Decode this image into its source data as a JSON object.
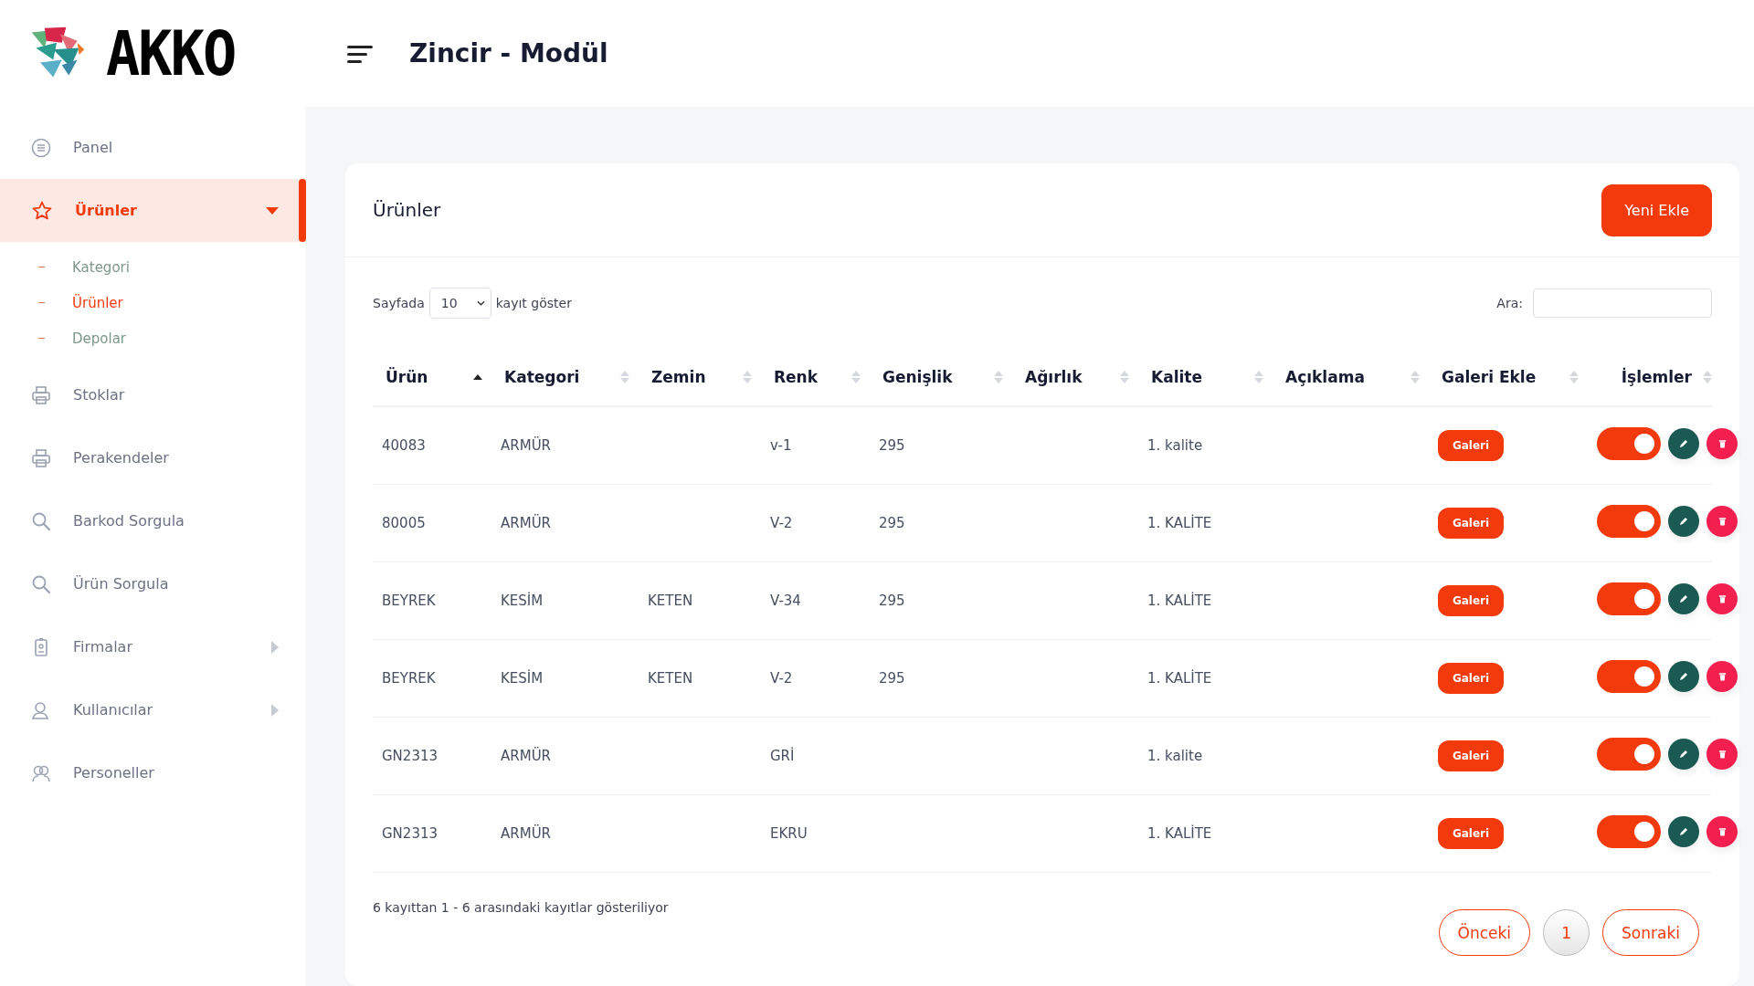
{
  "logo": {
    "text": "AKKO"
  },
  "header": {
    "title": "Zincir - Modül"
  },
  "sidebar": {
    "items": [
      {
        "label": "Panel",
        "kind": "list",
        "selected": false
      },
      {
        "label": "Ürünler",
        "kind": "star",
        "selected": true,
        "expanded": true,
        "children": [
          {
            "label": "Kategori",
            "selected": false
          },
          {
            "label": "Ürünler",
            "selected": true
          },
          {
            "label": "Depolar",
            "selected": false
          }
        ]
      },
      {
        "label": "Stoklar",
        "kind": "printer",
        "selected": false
      },
      {
        "label": "Perakendeler",
        "kind": "printer",
        "selected": false
      },
      {
        "label": "Barkod Sorgula",
        "kind": "search",
        "selected": false
      },
      {
        "label": "Ürün Sorgula",
        "kind": "search",
        "selected": false
      },
      {
        "label": "Firmalar",
        "kind": "badge",
        "selected": false,
        "expanded": false
      },
      {
        "label": "Kullanıcılar",
        "kind": "user",
        "selected": false,
        "expanded": false
      },
      {
        "label": "Personeller",
        "kind": "users",
        "selected": false
      }
    ]
  },
  "card": {
    "title": "Ürünler",
    "add_button": "Yeni Ekle",
    "length": {
      "before": "Sayfada",
      "value": "10",
      "after": "kayıt göster"
    },
    "search": {
      "label": "Ara:"
    },
    "table": {
      "columns": [
        {
          "label": "Ürün",
          "sorted": true
        },
        {
          "label": "Kategori",
          "sorted": false
        },
        {
          "label": "Zemin",
          "sorted": false
        },
        {
          "label": "Renk",
          "sorted": false
        },
        {
          "label": "Genişlik",
          "sorted": false
        },
        {
          "label": "Ağırlık",
          "sorted": false
        },
        {
          "label": "Kalite",
          "sorted": false
        },
        {
          "label": "Açıklama",
          "sorted": false
        },
        {
          "label": "Galeri Ekle",
          "sorted": false
        },
        {
          "label": "İşlemler",
          "sorted": false
        }
      ],
      "rows": [
        {
          "cells": [
            "40083",
            "ARMÜR",
            "",
            "v-1",
            "295",
            "",
            "1. kalite",
            ""
          ],
          "gallery": "Galeri",
          "active": true
        },
        {
          "cells": [
            "80005",
            "ARMÜR",
            "",
            "V-2",
            "295",
            "",
            "1. KALİTE",
            ""
          ],
          "gallery": "Galeri",
          "active": true
        },
        {
          "cells": [
            "BEYREK",
            "KESİM",
            "KETEN",
            "V-34",
            "295",
            "",
            "1. KALİTE",
            ""
          ],
          "gallery": "Galeri",
          "active": true
        },
        {
          "cells": [
            "BEYREK",
            "KESİM",
            "KETEN",
            "V-2",
            "295",
            "",
            "1. KALİTE",
            ""
          ],
          "gallery": "Galeri",
          "active": true
        },
        {
          "cells": [
            "GN2313",
            "ARMÜR",
            "",
            "GRİ",
            "",
            "",
            "1. kalite",
            ""
          ],
          "gallery": "Galeri",
          "active": true
        },
        {
          "cells": [
            "GN2313",
            "ARMÜR",
            "",
            "EKRU",
            "",
            "",
            "1. KALİTE",
            ""
          ],
          "gallery": "Galeri",
          "active": true
        }
      ]
    },
    "info": "6 kayıttan 1 - 6 arasındaki kayıtlar gösteriliyor",
    "pagination": {
      "previous": "Önceki",
      "pages": [
        {
          "label": "1",
          "selected": true
        }
      ],
      "next": "Sonraki"
    }
  }
}
